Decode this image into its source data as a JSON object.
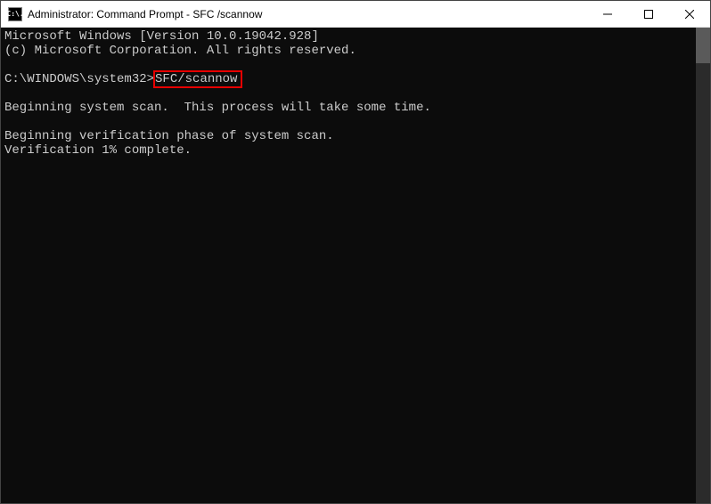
{
  "titlebar": {
    "icon_text": "C:\\.",
    "title": "Administrator: Command Prompt - SFC /scannow"
  },
  "terminal": {
    "line1": "Microsoft Windows [Version 10.0.19042.928]",
    "line2": "(c) Microsoft Corporation. All rights reserved.",
    "prompt_path": "C:\\WINDOWS\\system32>",
    "command": "SFC/scannow",
    "line_scan": "Beginning system scan.  This process will take some time.",
    "line_verify": "Beginning verification phase of system scan.",
    "line_progress": "Verification 1% complete."
  }
}
